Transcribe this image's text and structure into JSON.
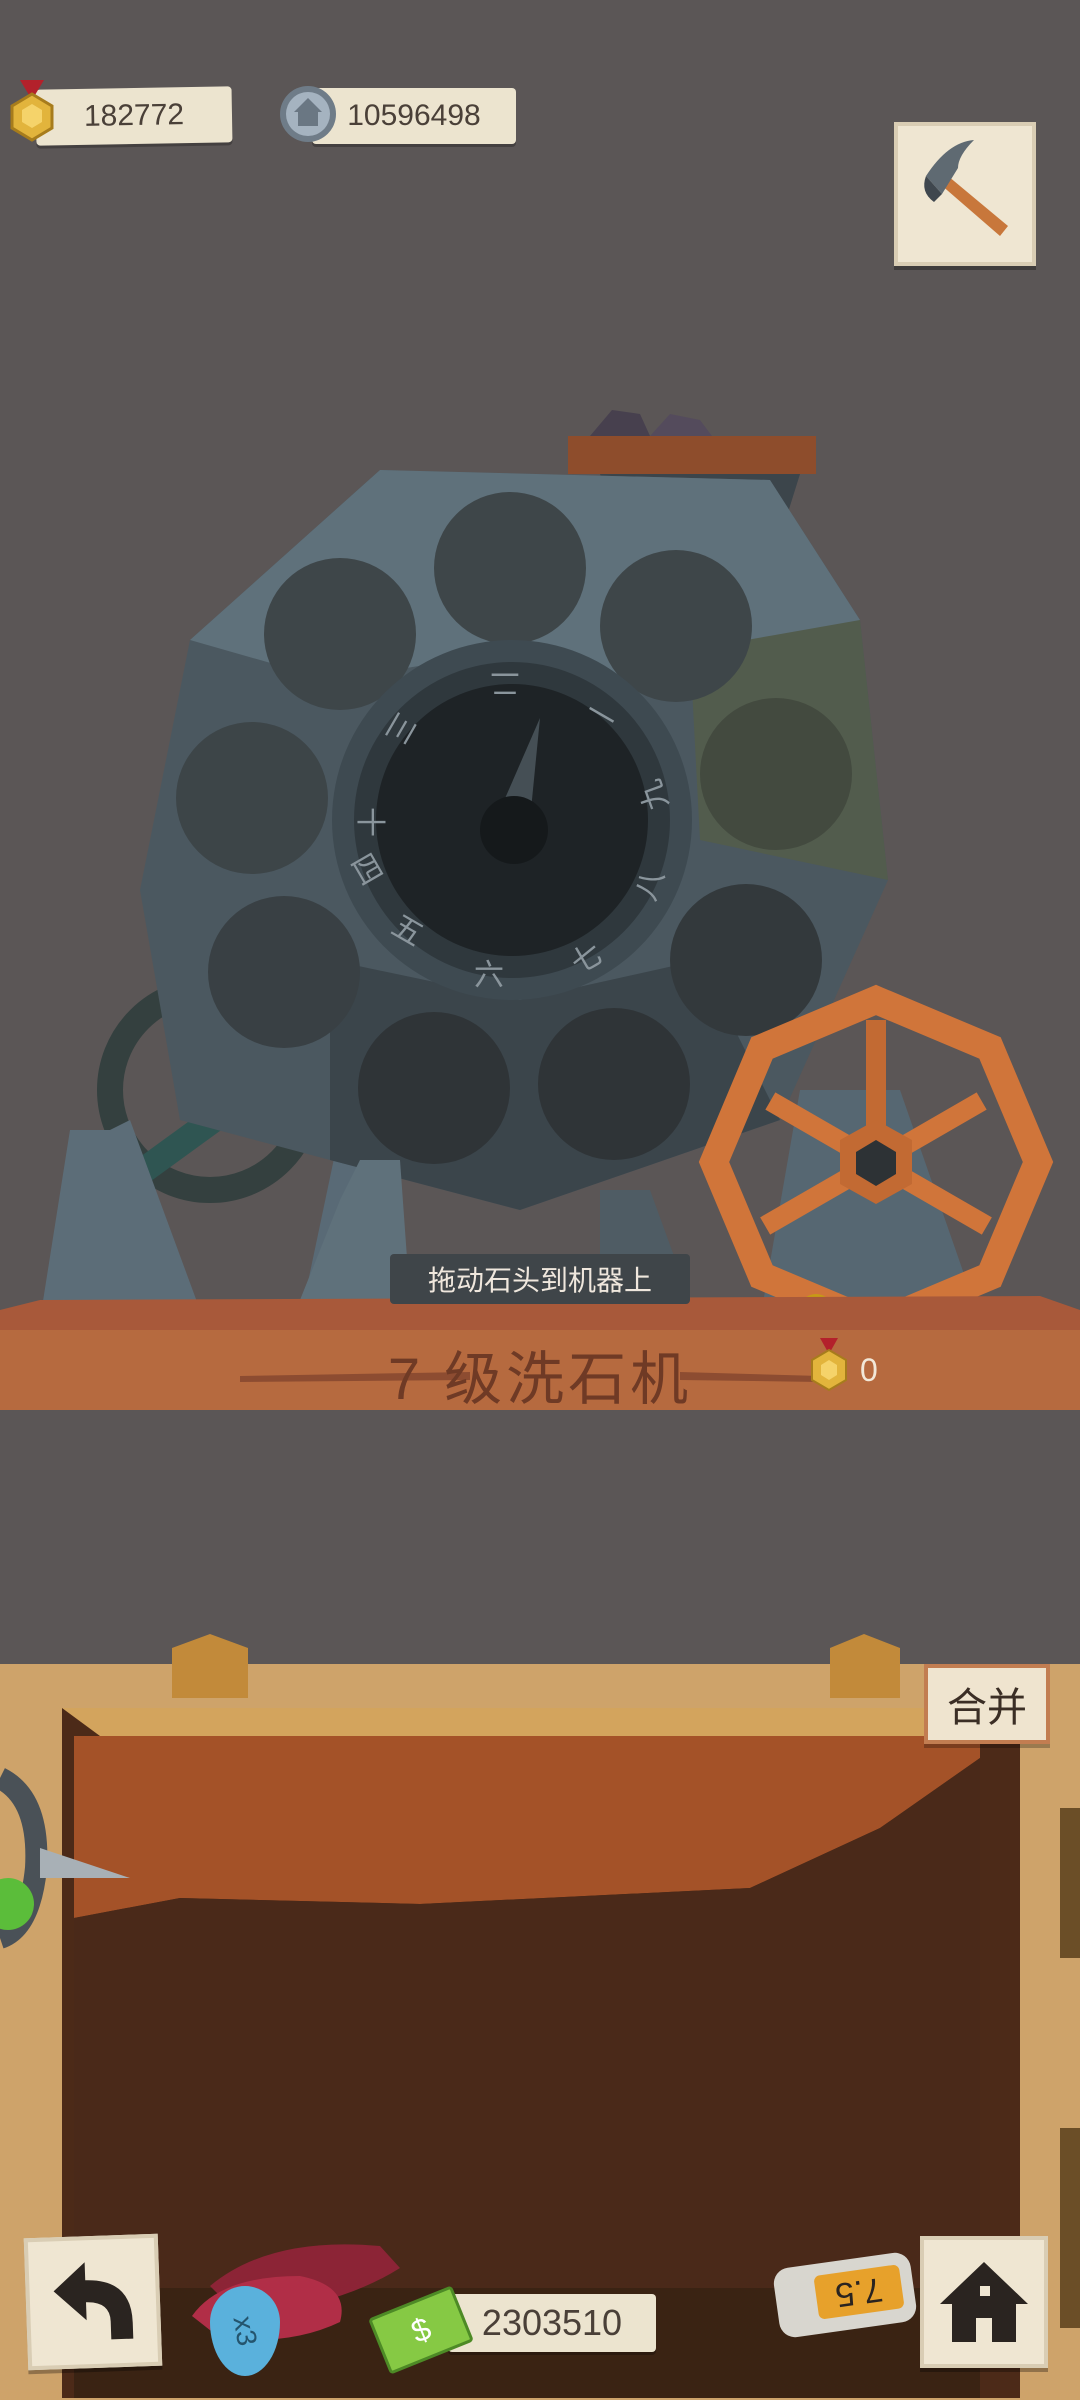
{
  "hud": {
    "medals": "182772",
    "gears": "10596498"
  },
  "machine": {
    "dial_chars": [
      "十",
      "三",
      "二",
      "一",
      "九",
      "八",
      "七",
      "六",
      "五",
      "四"
    ],
    "hint": "拖动石头到机器上",
    "level_title": "7 级洗石机",
    "medal_reward": "0"
  },
  "bin": {
    "merge_label": "合并"
  },
  "bottom": {
    "multiplier": "x3",
    "cash": "2303510",
    "rate": "7.5"
  }
}
